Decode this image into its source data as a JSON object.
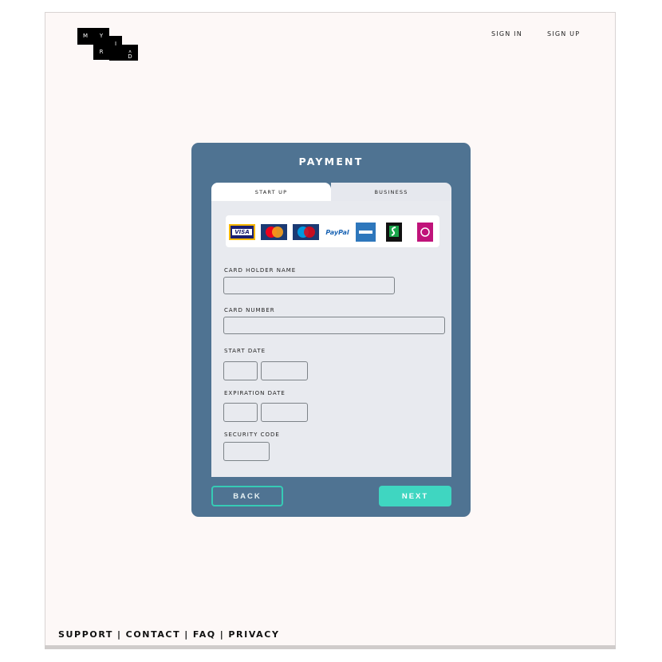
{
  "logo": {
    "letters": [
      "M",
      "Y",
      "R",
      "I",
      "A",
      "D"
    ]
  },
  "nav": {
    "sign_in": "SIGN IN",
    "sign_up": "SIGN UP"
  },
  "payment": {
    "title": "PAYMENT",
    "tabs": [
      {
        "label": "START UP",
        "active": true
      },
      {
        "label": "BUSINESS",
        "active": false
      }
    ],
    "card_icons": [
      "visa-card-icon",
      "mastercard-icon",
      "maestro-card-icon",
      "paypal-icon",
      "american-express-icon",
      "solo-card-icon",
      "switch-card-icon"
    ],
    "card_icon_text": {
      "visa": "VISA",
      "paypal": "PayPal"
    },
    "fields": {
      "card_holder_name": {
        "label": "CARD HOLDER NAME",
        "value": ""
      },
      "card_number": {
        "label": "CARD NUMBER",
        "value": ""
      },
      "start_date": {
        "label": "START DATE",
        "month": "",
        "year": ""
      },
      "expiration_date": {
        "label": "EXPIRATION DATE",
        "month": "",
        "year": ""
      },
      "security_code": {
        "label": "SECURITY CODE",
        "value": ""
      }
    },
    "buttons": {
      "back": "BACK",
      "next": "NEXT"
    }
  },
  "footer": {
    "links": [
      "SUPPORT",
      "CONTACT",
      "FAQ",
      "PRIVACY"
    ],
    "separator": "|"
  },
  "colors": {
    "page_bg": "#fdf8f7",
    "card_bg": "#4f7392",
    "panel_bg": "#e8eaef",
    "accent": "#3fd6c1"
  }
}
